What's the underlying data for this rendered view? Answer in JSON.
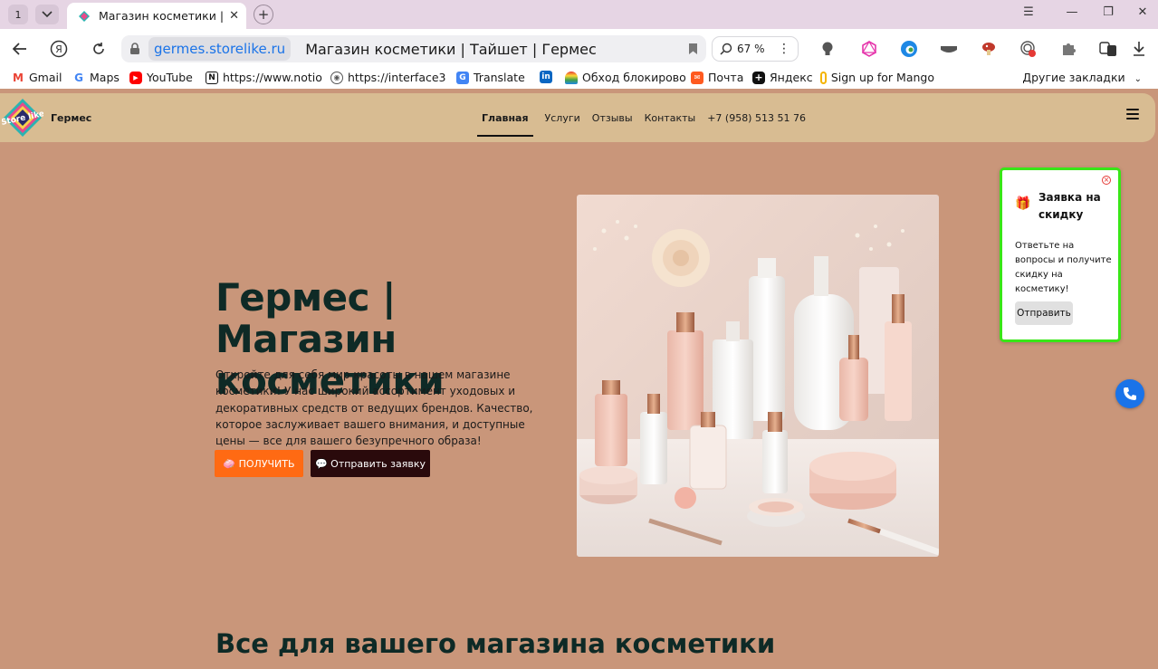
{
  "browser": {
    "tab_count": "1",
    "tab_title": "Магазин косметики | Т",
    "url_host": "germes.storelike.ru",
    "page_title": "Магазин косметики | Тайшет | Гермес",
    "zoom": "67 %",
    "bookmarks": [
      {
        "label": "Gmail",
        "icon": "gmail-icon"
      },
      {
        "label": "Maps",
        "icon": "google-icon"
      },
      {
        "label": "YouTube",
        "icon": "youtube-icon"
      },
      {
        "label": "https://www.notio",
        "icon": "notion-icon"
      },
      {
        "label": "https://interface3",
        "icon": "globe-icon"
      },
      {
        "label": "Translate",
        "icon": "translate-icon"
      },
      {
        "label": "",
        "icon": "linkedin-icon"
      },
      {
        "label": "Обход блокирово",
        "icon": "rainbow-icon"
      },
      {
        "label": "Почта",
        "icon": "mail-icon"
      },
      {
        "label": "Яндекс",
        "icon": "plus-icon"
      },
      {
        "label": "Sign up for Mango",
        "icon": "mango-icon"
      }
    ],
    "other_bookmarks": "Другие закладки"
  },
  "site": {
    "brand": "Гермес",
    "logo_text": "Store like",
    "nav": [
      "Главная",
      "Услуги",
      "Отзывы",
      "Контакты",
      "+7 (958) 513 51 76"
    ],
    "hero_title": "Гермес | Магазин косметики",
    "hero_text": "Откройте для себя мир красоты в нашем магазине косметики! У нас широкий ассортимент уходовых и декоративных средств от ведущих брендов. Качество, которое заслуживает вашего внимания, и доступные цены — все для вашего безупречного образа!",
    "btn_get": "🧼 ПОЛУЧИТЬ",
    "btn_send": "💬 Отправить заявку",
    "section_title": "Все для вашего магазина косметики"
  },
  "popup": {
    "title": "Заявка на скидку",
    "text": "Ответьте на вопросы и получите скидку на косметику!",
    "button": "Отправить"
  },
  "colors": {
    "page_bg": "#c9967a",
    "header_bg": "#d8bc92",
    "accent_orange": "#ff6a13",
    "dark_button": "#2a0a0c",
    "popup_border": "#39e617",
    "call_button": "#1a73e8"
  }
}
